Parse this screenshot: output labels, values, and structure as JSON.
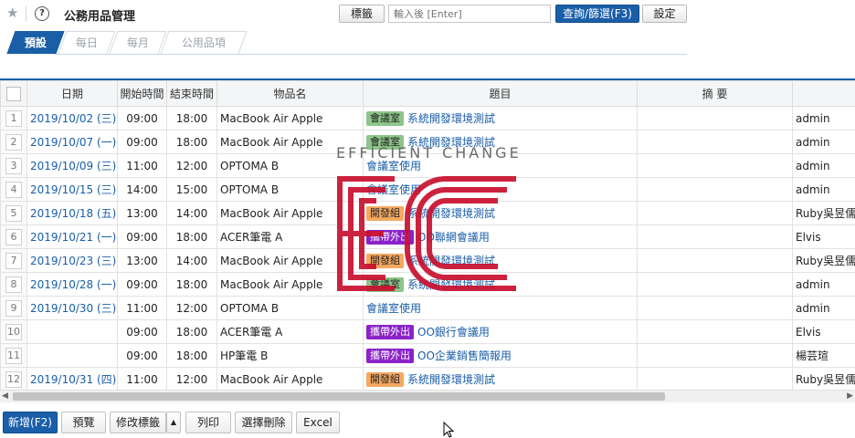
{
  "header": {
    "title": "公務用品管理",
    "help_glyph": "?",
    "star_glyph": "★",
    "tag_button": "標籤",
    "search_placeholder": "輸入後 [Enter]",
    "query_button": "查詢/篩選(F3)",
    "settings_button": "設定"
  },
  "tabs": [
    {
      "label": "預設",
      "active": true
    },
    {
      "label": "每日",
      "active": false
    },
    {
      "label": "每月",
      "active": false
    },
    {
      "label": "公用品項",
      "active": false
    }
  ],
  "table": {
    "headers": [
      "日期",
      "開始時間",
      "結束時間",
      "物品名",
      "題目",
      "摘 要",
      "用"
    ],
    "rows": [
      {
        "n": "1",
        "date": "2019/10/02 (三)",
        "start": "09:00",
        "end": "18:00",
        "item": "MacBook Air Apple",
        "tag": "會議室",
        "tag_color": "#8dc58a",
        "subject": "系統開發環境測試",
        "summary": "",
        "user": "admin"
      },
      {
        "n": "2",
        "date": "2019/10/07 (一)",
        "start": "09:00",
        "end": "18:00",
        "item": "MacBook Air Apple",
        "tag": "會議室",
        "tag_color": "#8dc58a",
        "subject": "系統開發環境測試",
        "summary": "",
        "user": "admin"
      },
      {
        "n": "3",
        "date": "2019/10/09 (三)",
        "start": "11:00",
        "end": "12:00",
        "item": "OPTOMA B",
        "tag": "",
        "tag_color": "",
        "subject": "會議室使用",
        "summary": "",
        "user": "admin"
      },
      {
        "n": "4",
        "date": "2019/10/15 (三)",
        "start": "14:00",
        "end": "15:00",
        "item": "OPTOMA B",
        "tag": "",
        "tag_color": "",
        "subject": "會議室使用",
        "summary": "",
        "user": "admin"
      },
      {
        "n": "5",
        "date": "2019/10/18 (五)",
        "start": "13:00",
        "end": "14:00",
        "item": "MacBook Air Apple",
        "tag": "開發組",
        "tag_color": "#f4a860",
        "subject": "系統開發環境測試",
        "summary": "",
        "user": "Ruby吳昱儒"
      },
      {
        "n": "6",
        "date": "2019/10/21 (一)",
        "start": "09:00",
        "end": "18:00",
        "item": "ACER筆電 A",
        "tag": "攜帶外出",
        "tag_color": "#8a22c9",
        "subject": "OO聯網會議用",
        "summary": "",
        "user": "Elvis"
      },
      {
        "n": "7",
        "date": "2019/10/23 (三)",
        "start": "13:00",
        "end": "14:00",
        "item": "MacBook Air Apple",
        "tag": "開發組",
        "tag_color": "#f4a860",
        "subject": "系統開發環境測試",
        "summary": "",
        "user": "Ruby吳昱儒"
      },
      {
        "n": "8",
        "date": "2019/10/28 (一)",
        "start": "09:00",
        "end": "18:00",
        "item": "MacBook Air Apple",
        "tag": "會議室",
        "tag_color": "#8dc58a",
        "subject": "系統開發環境測試",
        "summary": "",
        "user": "admin"
      },
      {
        "n": "9",
        "date": "2019/10/30 (三)",
        "start": "11:00",
        "end": "12:00",
        "item": "OPTOMA B",
        "tag": "",
        "tag_color": "",
        "subject": "會議室使用",
        "summary": "",
        "user": "admin"
      },
      {
        "n": "10",
        "date": "",
        "start": "09:00",
        "end": "18:00",
        "item": "ACER筆電 A",
        "tag": "攜帶外出",
        "tag_color": "#8a22c9",
        "subject": "OO銀行會議用",
        "summary": "",
        "user": "Elvis"
      },
      {
        "n": "11",
        "date": "",
        "start": "09:00",
        "end": "18:00",
        "item": "HP筆電 B",
        "tag": "攜帶外出",
        "tag_color": "#8a22c9",
        "subject": "OO企業銷售簡報用",
        "summary": "",
        "user": "楊芸瑄"
      },
      {
        "n": "12",
        "date": "2019/10/31 (四)",
        "start": "11:00",
        "end": "12:00",
        "item": "MacBook Air Apple",
        "tag": "開發組",
        "tag_color": "#f4a860",
        "subject": "系統開發環境測試",
        "summary": "",
        "user": "Ruby吳昱儒"
      }
    ]
  },
  "toolbar": {
    "add": "新增(F2)",
    "preview": "預覽",
    "edit_tags": "修改標籤",
    "dropdown_glyph": "▲",
    "print": "列印",
    "delete_selected": "選擇刪除",
    "excel": "Excel"
  },
  "watermark": {
    "tagline": "EFFICIENT CHANGE",
    "brand_color": "#c8102e"
  }
}
